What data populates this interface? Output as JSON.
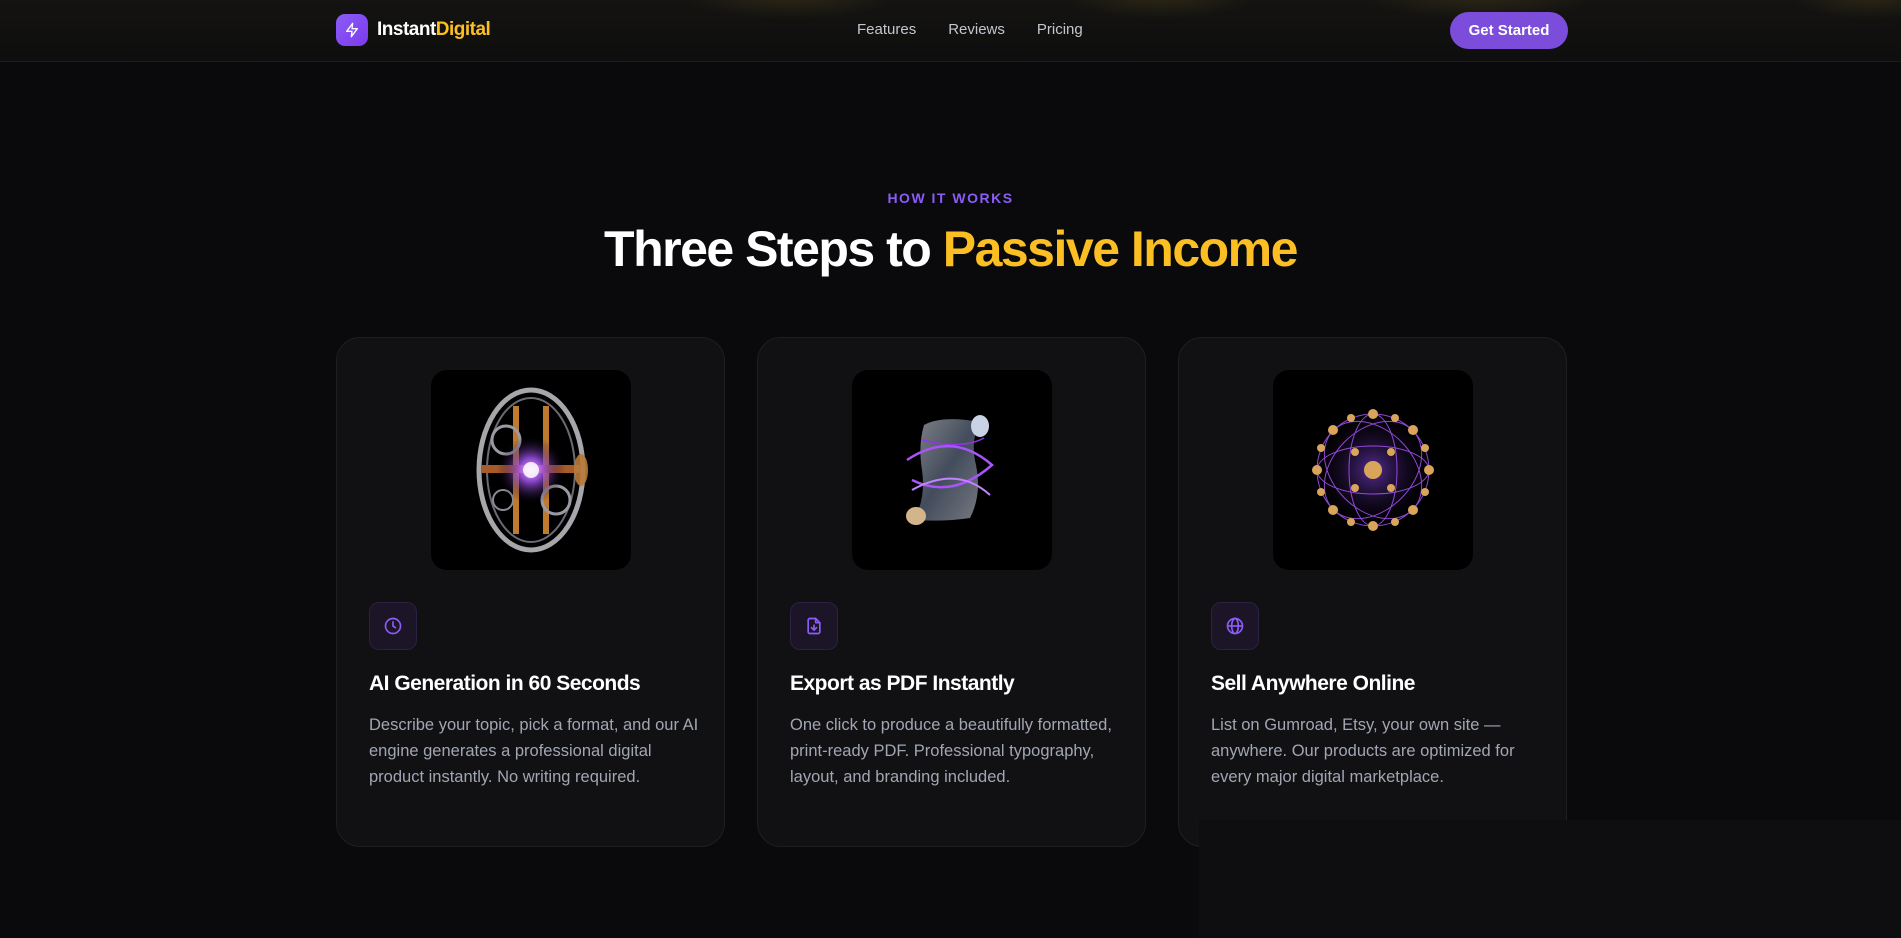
{
  "header": {
    "logo": {
      "icon": "lightning-icon",
      "name_part1": "Instant",
      "name_part2": "Digital"
    },
    "nav": [
      "Features",
      "Reviews",
      "Pricing"
    ],
    "cta_label": "Get Started"
  },
  "section": {
    "eyebrow": "HOW IT WORKS",
    "title_part1": "Three Steps to ",
    "title_part2": "Passive Income"
  },
  "steps": [
    {
      "art": "mechanical-gyroscope-orb",
      "icon": "clock-icon",
      "title": "AI Generation in 60 Seconds",
      "description": "Describe your topic, pick a format, and our AI engine generates a professional digital product instantly. No writing required."
    },
    {
      "art": "glowing-scroll",
      "icon": "file-download-icon",
      "title": "Export as PDF Instantly",
      "description": "One click to produce a beautifully formatted, print-ready PDF. Professional typography, layout, and branding included."
    },
    {
      "art": "network-sphere",
      "icon": "globe-icon",
      "title": "Sell Anywhere Online",
      "description": "List on Gumroad, Etsy, your own site — anywhere. Our products are optimized for every major digital marketplace."
    }
  ],
  "colors": {
    "accent_purple": "#8b5cf6",
    "accent_yellow": "#fbbf24",
    "background": "#0a0a0c",
    "card": "#111113"
  }
}
